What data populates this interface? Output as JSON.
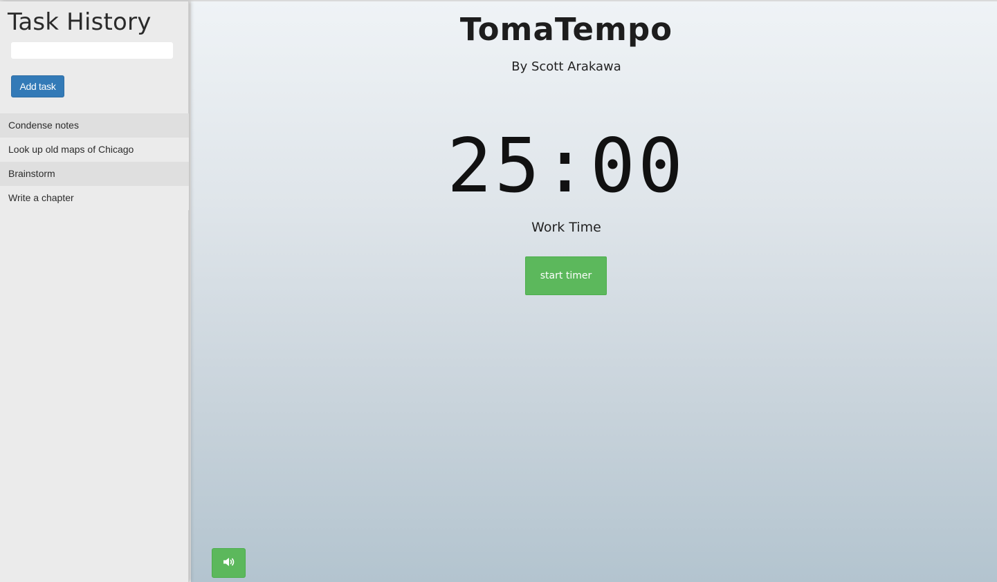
{
  "sidebar": {
    "title": "Task History",
    "input": {
      "value": "",
      "placeholder": ""
    },
    "add_button_label": "Add task",
    "tasks": [
      {
        "label": "Condense notes"
      },
      {
        "label": "Look up old maps of Chicago"
      },
      {
        "label": "Brainstorm"
      },
      {
        "label": "Write a chapter"
      }
    ]
  },
  "main": {
    "title": "TomaTempo",
    "subtitle": "By Scott Arakawa",
    "timer": "25:00",
    "mode": "Work Time",
    "start_button_label": "start timer",
    "sound_icon": "volume-icon"
  },
  "colors": {
    "primary_button": "#337ab7",
    "success_button": "#5cb85c",
    "sidebar_bg": "#ebebeb"
  }
}
